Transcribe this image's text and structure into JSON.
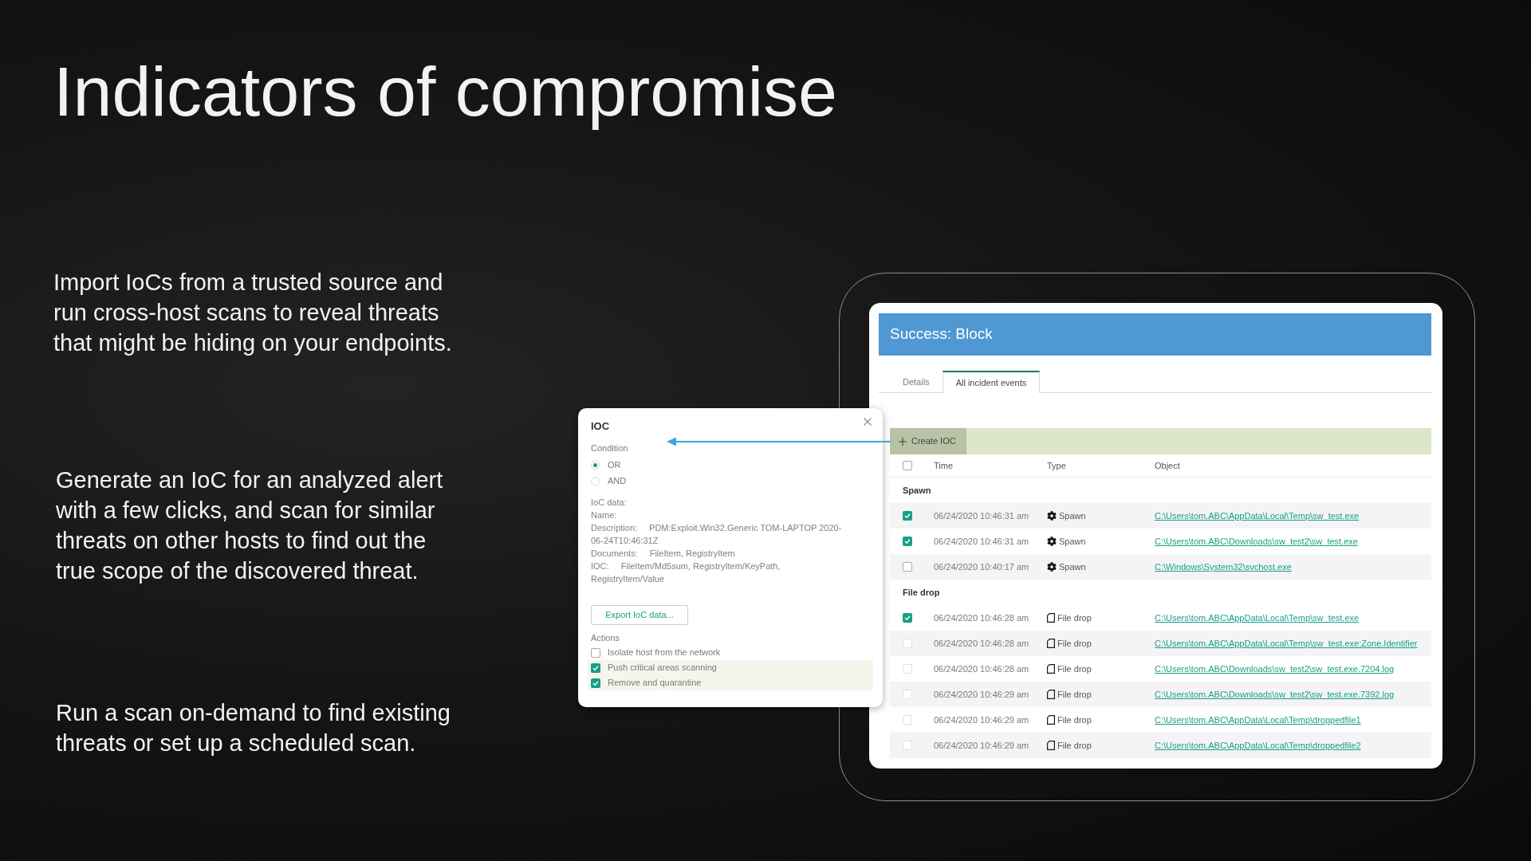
{
  "slide": {
    "title": "Indicators of compromise",
    "paragraphs": [
      "Import IoCs from a trusted source and run cross-host scans to reveal threats that might be hiding on your endpoints.",
      "Generate an IoC for an analyzed alert with a few clicks, and scan for similar threats on other hosts to find out the true scope of the discovered threat.",
      "Run a scan on-demand to find existing threats or set up a scheduled scan."
    ]
  },
  "ioc_dialog": {
    "title": "IOC",
    "condition": {
      "label": "Condition",
      "options": [
        {
          "label": "OR",
          "selected": true
        },
        {
          "label": "AND",
          "selected": false
        }
      ]
    },
    "ioc_data": {
      "heading": "IoC data:",
      "fields": [
        {
          "label": "Name:"
        },
        {
          "label": "Description:",
          "value": "PDM:Exploit.Win32.Generic TOM-LAPTOP 2020-06-24T10:46:31Z"
        },
        {
          "label": "Documents:",
          "value": "FileItem, RegistryItem"
        },
        {
          "label": "IOC:",
          "value": "FileItem/Md5sum, RegistryItem/KeyPath, RegistryItem/Value"
        }
      ]
    },
    "export_button": "Export IoC data...",
    "actions": {
      "label": "Actions",
      "items": [
        {
          "label": "Isolate host from the network",
          "checked": false
        },
        {
          "label": "Push critical areas scanning",
          "checked": true
        },
        {
          "label": "Remove and quarantine",
          "checked": true
        }
      ]
    }
  },
  "incident_window": {
    "header": "Success: Block",
    "tabs": [
      {
        "label": "Details",
        "selected": false
      },
      {
        "label": "All incident events",
        "selected": true
      }
    ],
    "create_button": "Create IOC",
    "table": {
      "select_all_checked": false,
      "columns": [
        "Time",
        "Type",
        "Object"
      ],
      "groups": [
        {
          "label": "Spawn",
          "rows": [
            {
              "checked": true,
              "disabled": false,
              "time": "06/24/2020 10:46:31 am",
              "kind": "spawn",
              "type": "Spawn",
              "object": "C:\\Users\\tom.ABC\\AppData\\Local\\Temp\\sw_test.exe"
            },
            {
              "checked": true,
              "disabled": false,
              "time": "06/24/2020 10:46:31 am",
              "kind": "spawn",
              "type": "Spawn",
              "object": "C:\\Users\\tom.ABC\\Downloads\\sw_test2\\sw_test.exe"
            },
            {
              "checked": false,
              "disabled": false,
              "time": "06/24/2020 10:40:17 am",
              "kind": "spawn",
              "type": "Spawn",
              "object": "C:\\Windows\\System32\\svchost.exe"
            }
          ]
        },
        {
          "label": "File drop",
          "rows": [
            {
              "checked": true,
              "disabled": false,
              "time": "06/24/2020 10:46:28 am",
              "kind": "file",
              "type": "File drop",
              "object": "C:\\Users\\tom.ABC\\AppData\\Local\\Temp\\sw_test.exe"
            },
            {
              "checked": false,
              "disabled": true,
              "time": "06/24/2020 10:46:28 am",
              "kind": "file",
              "type": "File drop",
              "object": "C:\\Users\\tom.ABC\\AppData\\Local\\Temp\\sw_test.exe:Zone.Identifier"
            },
            {
              "checked": false,
              "disabled": true,
              "time": "06/24/2020 10:46:28 am",
              "kind": "file",
              "type": "File drop",
              "object": "C:\\Users\\tom.ABC\\Downloads\\sw_test2\\sw_test.exe.7204.log"
            },
            {
              "checked": false,
              "disabled": true,
              "time": "06/24/2020 10:46:29 am",
              "kind": "file",
              "type": "File drop",
              "object": "C:\\Users\\tom.ABC\\Downloads\\sw_test2\\sw_test.exe.7392.log"
            },
            {
              "checked": false,
              "disabled": true,
              "time": "06/24/2020 10:46:29 am",
              "kind": "file",
              "type": "File drop",
              "object": "C:\\Users\\tom.ABC\\AppData\\Local\\Temp\\droppedfile1"
            },
            {
              "checked": false,
              "disabled": true,
              "time": "06/24/2020 10:46:29 am",
              "kind": "file",
              "type": "File drop",
              "object": "C:\\Users\\tom.ABC\\AppData\\Local\\Temp\\droppedfile2"
            }
          ]
        }
      ]
    }
  }
}
